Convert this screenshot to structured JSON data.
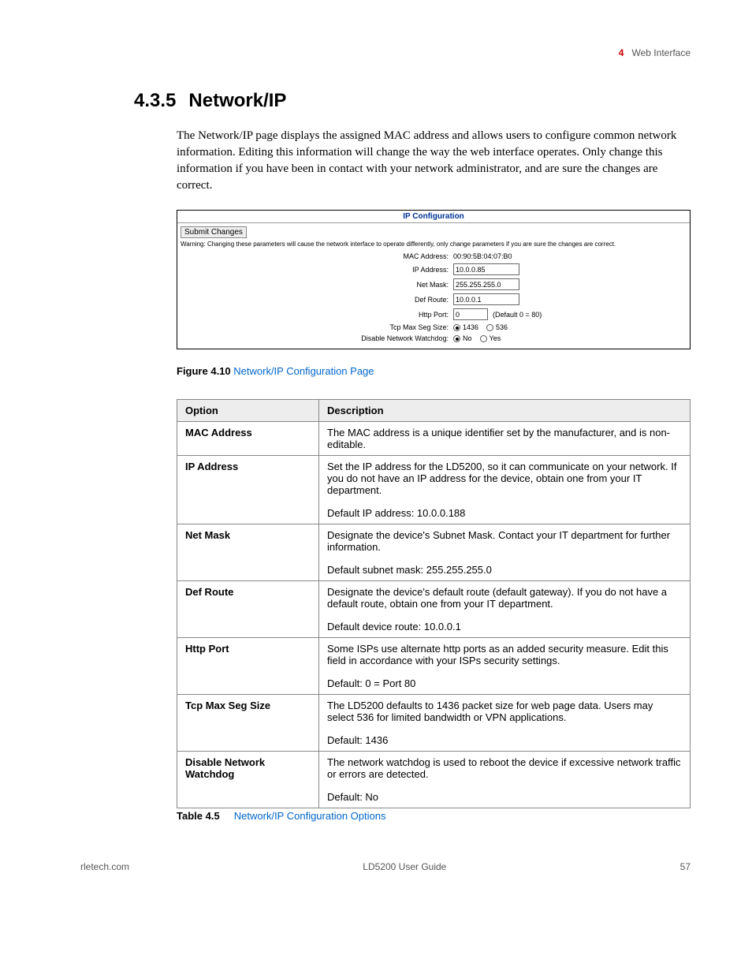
{
  "header": {
    "num": "4",
    "text": "Web Interface"
  },
  "section": {
    "num": "4.3.5",
    "title": "Network/IP"
  },
  "intro": "The Network/IP page displays the assigned MAC address and allows users to configure common network information. Editing this information will change the way the web interface operates. Only change this information if you have been in contact with your network administrator, and are sure the changes are correct.",
  "ipconfig": {
    "title": "IP Configuration",
    "submit": "Submit Changes",
    "warning": "Warning: Changing these parameters will cause the network interface to operate differently, only change parameters if you are sure the changes are correct.",
    "mac_label": "MAC Address:",
    "mac_value": "00:90:5B:04:07:B0",
    "ip_label": "IP Address:",
    "ip_value": "10.0.0.85",
    "netmask_label": "Net Mask:",
    "netmask_value": "255.255.255.0",
    "defroute_label": "Def Route:",
    "defroute_value": "10.0.0.1",
    "httpport_label": "Http Port:",
    "httpport_value": "0",
    "httpport_hint": "(Default 0 = 80)",
    "tcpseg_label": "Tcp Max Seg Size:",
    "tcpseg_opt1": "1436",
    "tcpseg_opt2": "536",
    "watchdog_label": "Disable Network Watchdog:",
    "watchdog_opt1": "No",
    "watchdog_opt2": "Yes"
  },
  "figure_caption": {
    "bold": "Figure 4.10",
    "link": "Network/IP Configuration Page"
  },
  "table": {
    "head_opt": "Option",
    "head_desc": "Description",
    "rows": [
      {
        "opt": "MAC Address",
        "desc": [
          "The MAC address is a unique identifier set by the manufacturer, and is non-editable."
        ]
      },
      {
        "opt": "IP Address",
        "desc": [
          "Set the IP address for the LD5200, so it can communicate on your network. If you do not have an IP address for the device, obtain one from your IT department.",
          "Default IP address: 10.0.0.188"
        ]
      },
      {
        "opt": "Net Mask",
        "desc": [
          "Designate the device's Subnet Mask. Contact your IT department for further information.",
          "Default subnet mask: 255.255.255.0"
        ]
      },
      {
        "opt": "Def Route",
        "desc": [
          "Designate the device's default route (default gateway). If you do not have a default route, obtain one from your IT department.",
          "Default device route: 10.0.0.1"
        ]
      },
      {
        "opt": "Http Port",
        "desc": [
          "Some ISPs use alternate http ports as an added security measure. Edit this field in accordance with your ISPs security settings.",
          "Default: 0 = Port 80"
        ]
      },
      {
        "opt": "Tcp Max Seg Size",
        "desc": [
          "The LD5200 defaults to 1436 packet size for web page data. Users may select 536 for limited bandwidth or VPN applications.",
          "Default: 1436"
        ]
      },
      {
        "opt": "Disable Network Watchdog",
        "desc": [
          "The network watchdog is used to reboot the device if excessive network traffic or errors are detected.",
          "Default: No"
        ]
      }
    ]
  },
  "table_caption": {
    "bold": "Table 4.5",
    "link": "Network/IP Configuration Options"
  },
  "footer": {
    "left": "rletech.com",
    "center": "LD5200 User Guide",
    "right": "57"
  }
}
